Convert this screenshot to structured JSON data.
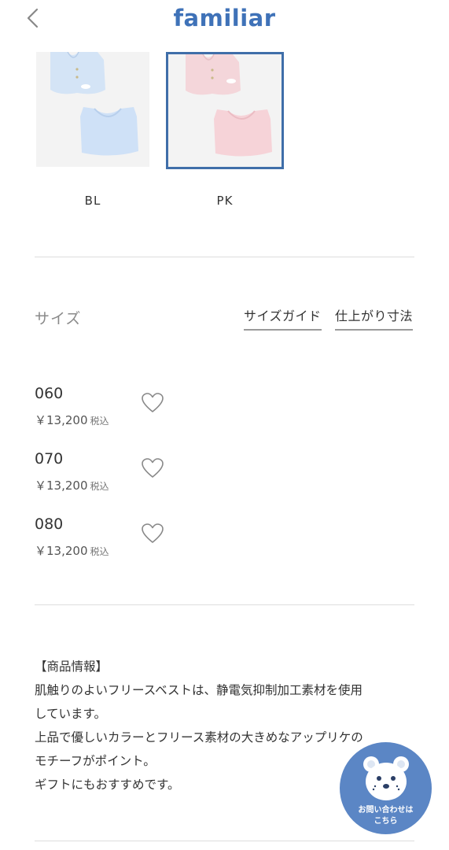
{
  "header": {
    "logo_text": "familiar",
    "back_icon": "chevron-left-icon"
  },
  "colors": {
    "brand": "#3f72b8",
    "selected_border": "#3f6ea9",
    "contact_bg": "#5b86c5",
    "divider": "#dddddd"
  },
  "swatches": [
    {
      "label": "BL",
      "selected": false,
      "color": "#cfe0f5"
    },
    {
      "label": "PK",
      "selected": true,
      "color": "#f6d5d9"
    }
  ],
  "size_section": {
    "heading": "サイズ",
    "size_guide_link": "サイズガイド",
    "measurements_link": "仕上がり寸法",
    "items": [
      {
        "code": "060",
        "price": "￥13,200",
        "tax_label": "税込",
        "heart_icon": "heart-outline-icon"
      },
      {
        "code": "070",
        "price": "￥13,200",
        "tax_label": "税込",
        "heart_icon": "heart-outline-icon"
      },
      {
        "code": "080",
        "price": "￥13,200",
        "tax_label": "税込",
        "heart_icon": "heart-outline-icon"
      }
    ]
  },
  "product_info": {
    "lines": [
      "【商品情報】",
      "肌触りのよいフリースベストは、静電気抑制加工素材を使用",
      "しています。",
      "上品で優しいカラーとフリース素材の大きめなアップリケの",
      "モチーフがポイント。",
      "ギフトにもおすすめです。"
    ]
  },
  "contact_button": {
    "line1": "お問い合わせは",
    "line2": "こちら",
    "icon": "bear-icon"
  }
}
